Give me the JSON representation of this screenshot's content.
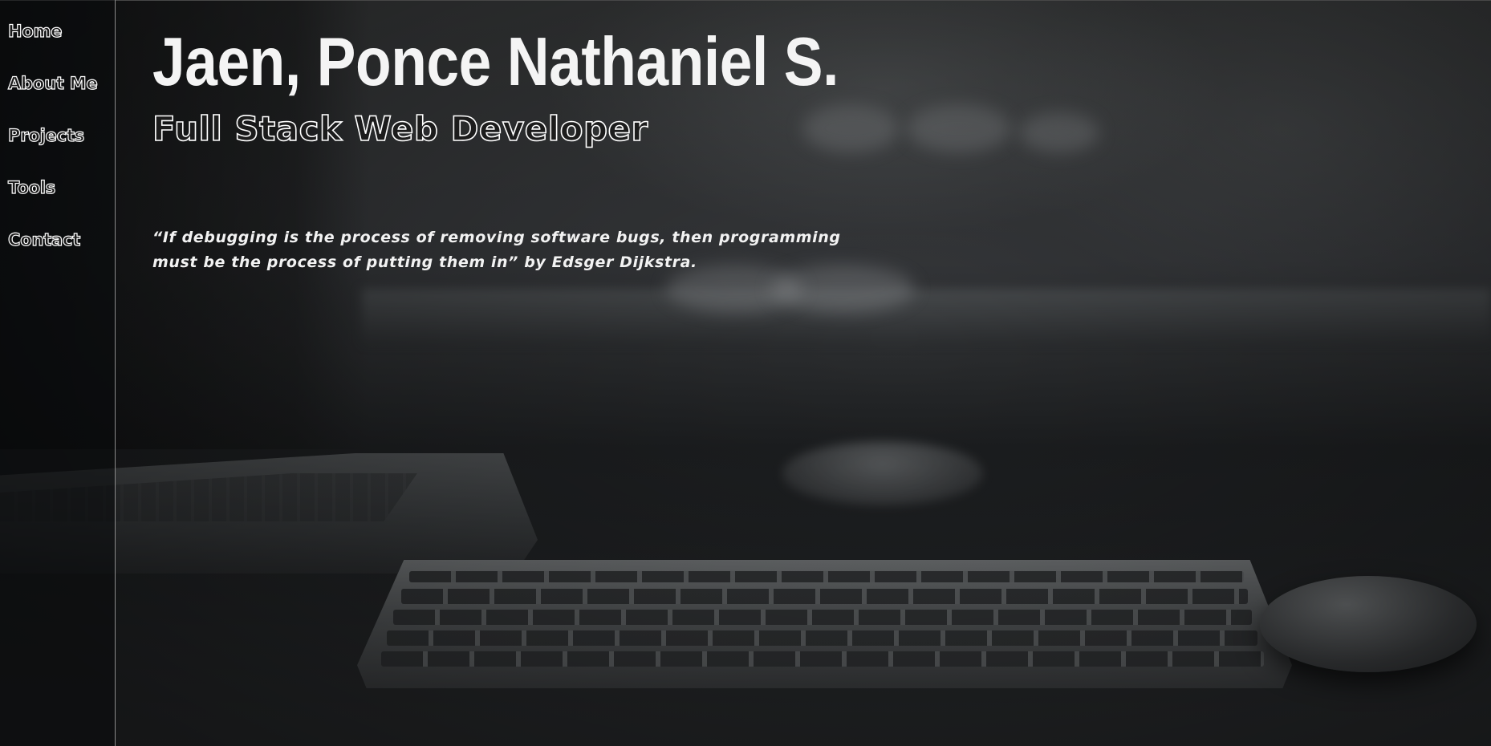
{
  "nav": {
    "items": [
      {
        "label": "Home"
      },
      {
        "label": "About Me"
      },
      {
        "label": "Projects"
      },
      {
        "label": "Tools"
      },
      {
        "label": "Contact"
      }
    ]
  },
  "hero": {
    "name": "Jaen, Ponce Nathaniel S.",
    "role": "Full Stack Web Developer",
    "quote": "“If debugging is the process of removing software bugs, then programming must be the process of putting them in” by Edsger Dijkstra."
  },
  "colors": {
    "text": "#ffffff",
    "sidebar_border": "#8a8a8a",
    "background": "#141516"
  }
}
